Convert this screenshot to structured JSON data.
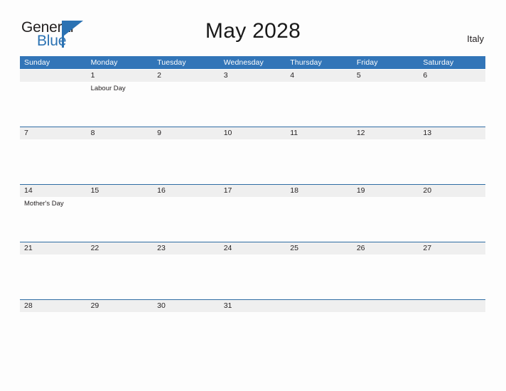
{
  "brand": {
    "word_one": "General",
    "word_two": "Blue",
    "flag_icon": "triangle-flag-icon"
  },
  "header": {
    "title": "May 2028",
    "country": "Italy"
  },
  "colors": {
    "header_blue": "#3275b8",
    "rule_blue": "#2e6ca3",
    "band_gray": "#efefef",
    "brand_blue": "#2b72b3",
    "text": "#231f20",
    "page_background": "#fdfdfd"
  },
  "calendar": {
    "month": "May",
    "year": "2028",
    "weekday_headers": [
      "Sunday",
      "Monday",
      "Tuesday",
      "Wednesday",
      "Thursday",
      "Friday",
      "Saturday"
    ],
    "weeks": [
      {
        "days": [
          {
            "num": "",
            "events": []
          },
          {
            "num": "1",
            "events": [
              "Labour Day"
            ]
          },
          {
            "num": "2",
            "events": []
          },
          {
            "num": "3",
            "events": []
          },
          {
            "num": "4",
            "events": []
          },
          {
            "num": "5",
            "events": []
          },
          {
            "num": "6",
            "events": []
          }
        ]
      },
      {
        "days": [
          {
            "num": "7",
            "events": []
          },
          {
            "num": "8",
            "events": []
          },
          {
            "num": "9",
            "events": []
          },
          {
            "num": "10",
            "events": []
          },
          {
            "num": "11",
            "events": []
          },
          {
            "num": "12",
            "events": []
          },
          {
            "num": "13",
            "events": []
          }
        ]
      },
      {
        "days": [
          {
            "num": "14",
            "events": [
              "Mother's Day"
            ]
          },
          {
            "num": "15",
            "events": []
          },
          {
            "num": "16",
            "events": []
          },
          {
            "num": "17",
            "events": []
          },
          {
            "num": "18",
            "events": []
          },
          {
            "num": "19",
            "events": []
          },
          {
            "num": "20",
            "events": []
          }
        ]
      },
      {
        "days": [
          {
            "num": "21",
            "events": []
          },
          {
            "num": "22",
            "events": []
          },
          {
            "num": "23",
            "events": []
          },
          {
            "num": "24",
            "events": []
          },
          {
            "num": "25",
            "events": []
          },
          {
            "num": "26",
            "events": []
          },
          {
            "num": "27",
            "events": []
          }
        ]
      },
      {
        "days": [
          {
            "num": "28",
            "events": []
          },
          {
            "num": "29",
            "events": []
          },
          {
            "num": "30",
            "events": []
          },
          {
            "num": "31",
            "events": []
          },
          {
            "num": "",
            "events": []
          },
          {
            "num": "",
            "events": []
          },
          {
            "num": "",
            "events": []
          }
        ]
      }
    ]
  }
}
